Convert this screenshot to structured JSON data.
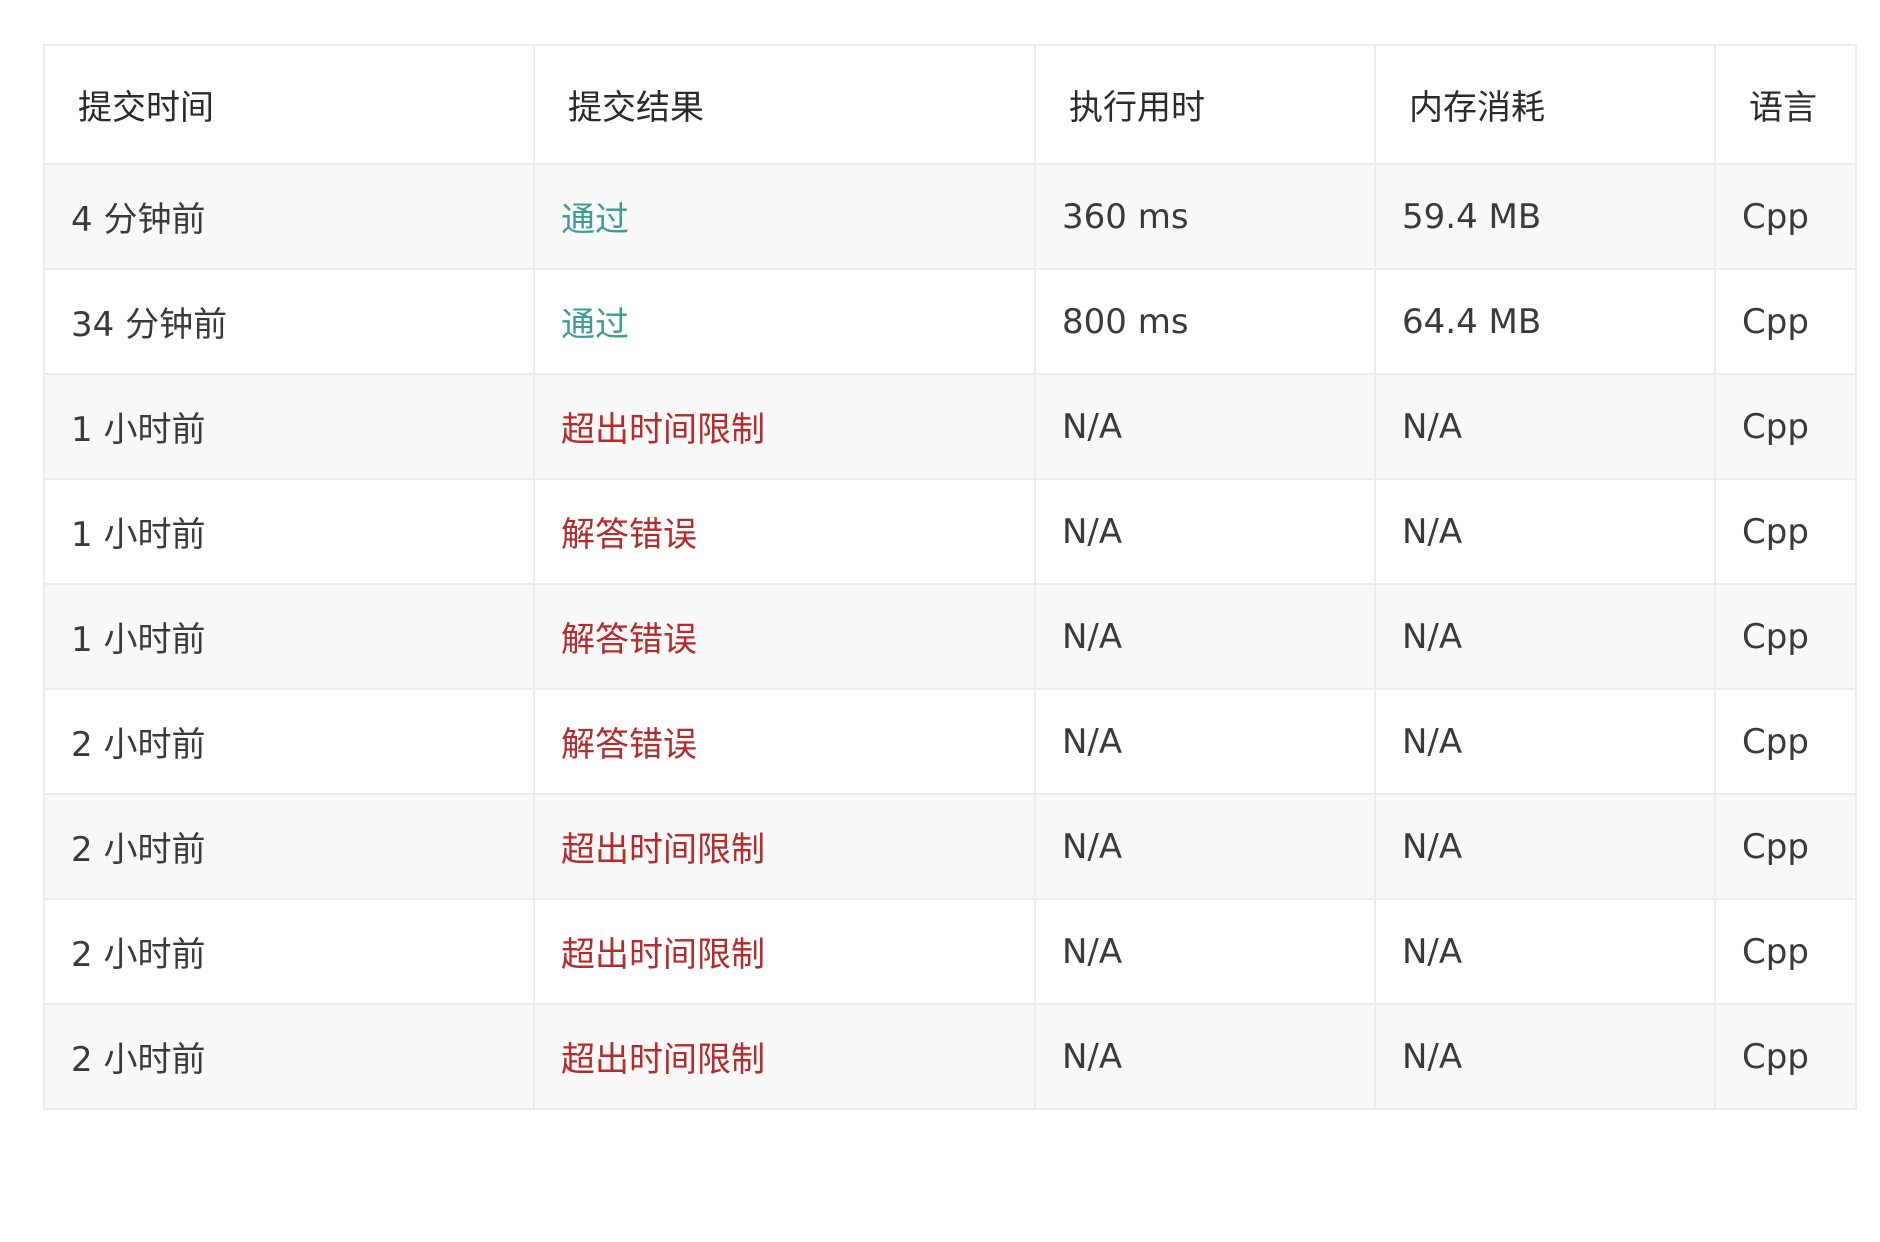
{
  "table": {
    "headers": [
      "提交时间",
      "提交结果",
      "执行用时",
      "内存消耗",
      "语言"
    ],
    "rows": [
      {
        "time": "4 分钟前",
        "status": "通过",
        "status_type": "accepted",
        "runtime": "360 ms",
        "memory": "59.4 MB",
        "language": "Cpp"
      },
      {
        "time": "34 分钟前",
        "status": "通过",
        "status_type": "accepted",
        "runtime": "800 ms",
        "memory": "64.4 MB",
        "language": "Cpp"
      },
      {
        "time": "1 小时前",
        "status": "超出时间限制",
        "status_type": "failed",
        "runtime": "N/A",
        "memory": "N/A",
        "language": "Cpp"
      },
      {
        "time": "1 小时前",
        "status": "解答错误",
        "status_type": "failed",
        "runtime": "N/A",
        "memory": "N/A",
        "language": "Cpp"
      },
      {
        "time": "1 小时前",
        "status": "解答错误",
        "status_type": "failed",
        "runtime": "N/A",
        "memory": "N/A",
        "language": "Cpp"
      },
      {
        "time": "2 小时前",
        "status": "解答错误",
        "status_type": "failed",
        "runtime": "N/A",
        "memory": "N/A",
        "language": "Cpp"
      },
      {
        "time": "2 小时前",
        "status": "超出时间限制",
        "status_type": "failed",
        "runtime": "N/A",
        "memory": "N/A",
        "language": "Cpp"
      },
      {
        "time": "2 小时前",
        "status": "超出时间限制",
        "status_type": "failed",
        "runtime": "N/A",
        "memory": "N/A",
        "language": "Cpp"
      },
      {
        "time": "2 小时前",
        "status": "超出时间限制",
        "status_type": "failed",
        "runtime": "N/A",
        "memory": "N/A",
        "language": "Cpp"
      }
    ]
  },
  "colors": {
    "accepted": "#3c9e8f",
    "failed": "#b52a2a",
    "row_stripe": "#f8f8f8",
    "border": "#ececec"
  }
}
